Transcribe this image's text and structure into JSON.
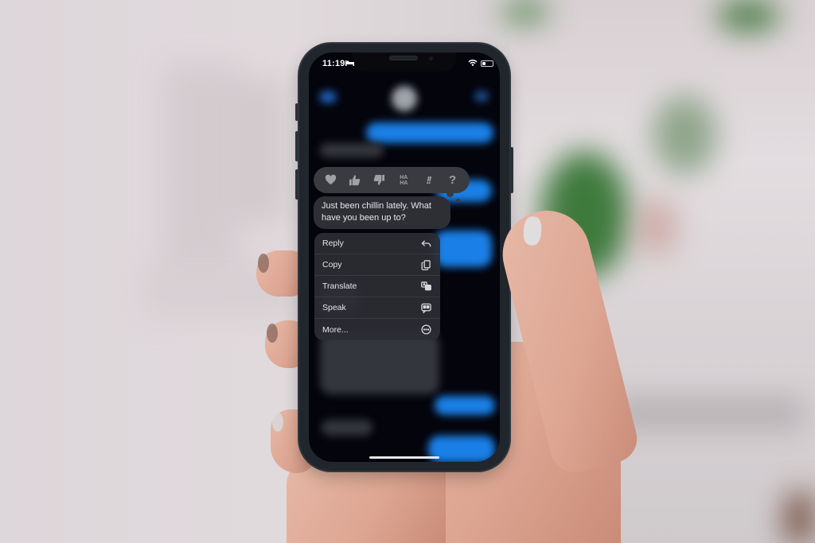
{
  "scene": {
    "description": "Hand holding a smartphone showing a Messages conversation with a message context menu open",
    "colors": {
      "sent_bubble": "#1a7fe6",
      "received_bubble": "#2e2f34",
      "menu_background": "#2c2e34",
      "screen_background": "#04040c"
    }
  },
  "status_bar": {
    "time": "11:19",
    "icons": [
      "sleep-focus-icon",
      "wifi-icon",
      "battery-icon"
    ],
    "battery_level": 0.4
  },
  "tapback": {
    "reactions": [
      {
        "name": "heart",
        "icon": "heart-icon"
      },
      {
        "name": "thumbs-up",
        "icon": "thumbs-up-icon"
      },
      {
        "name": "thumbs-down",
        "icon": "thumbs-down-icon"
      },
      {
        "name": "haha",
        "icon": "haha-icon",
        "label_top": "HA",
        "label_bottom": "HA"
      },
      {
        "name": "emphasize",
        "icon": "double-exclamation-icon",
        "label": "!!"
      },
      {
        "name": "question",
        "icon": "question-icon",
        "label": "?"
      }
    ]
  },
  "message": {
    "text": "Just been chillin lately. What have you been up to?"
  },
  "context_menu": {
    "items": [
      {
        "label": "Reply",
        "icon": "reply-icon"
      },
      {
        "label": "Copy",
        "icon": "copy-icon"
      },
      {
        "label": "Translate",
        "icon": "translate-icon"
      },
      {
        "label": "Speak",
        "icon": "speak-icon"
      },
      {
        "label": "More...",
        "icon": "more-icon"
      }
    ]
  }
}
